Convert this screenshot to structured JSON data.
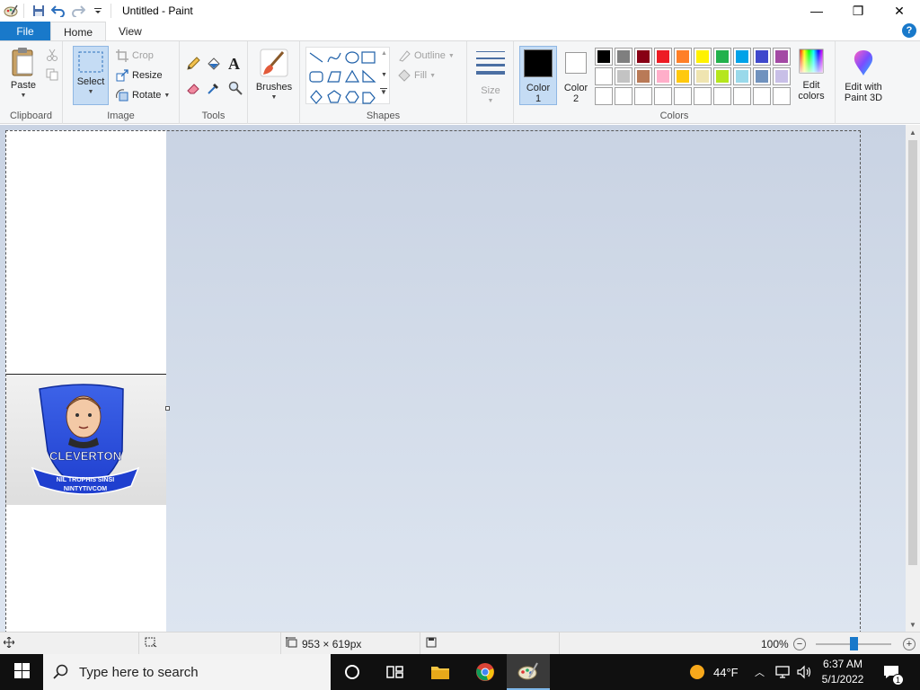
{
  "window": {
    "title": "Untitled - Paint",
    "minimize_glyph": "—",
    "restore_glyph": "❐",
    "close_glyph": "✕"
  },
  "tabs": [
    {
      "label": "File"
    },
    {
      "label": "Home"
    },
    {
      "label": "View"
    }
  ],
  "help_glyph": "?",
  "ribbon": {
    "clipboard": {
      "label": "Clipboard",
      "paste": "Paste"
    },
    "image": {
      "label": "Image",
      "select": "Select",
      "crop": "Crop",
      "resize": "Resize",
      "rotate": "Rotate"
    },
    "tools": {
      "label": "Tools",
      "text_glyph": "A"
    },
    "brushes": {
      "label": "Brushes"
    },
    "shapes": {
      "label": "Shapes",
      "outline": "Outline",
      "fill": "Fill"
    },
    "size": {
      "label": "Size"
    },
    "colors": {
      "label": "Colors",
      "color1_line1": "Color",
      "color1_line2": "1",
      "color2_line1": "Color",
      "color2_line2": "2",
      "edit_colors_line1": "Edit",
      "edit_colors_line2": "colors",
      "color1_value": "#000000",
      "color2_value": "#ffffff",
      "palette": [
        "#000000",
        "#7f7f7f",
        "#880015",
        "#ed1c24",
        "#ff7f27",
        "#fff200",
        "#22b14c",
        "#00a2e8",
        "#3f48cc",
        "#a349a4",
        "#ffffff",
        "#c3c3c3",
        "#b97a57",
        "#ffaec9",
        "#ffc90e",
        "#efe4b0",
        "#b5e61d",
        "#99d9ea",
        "#7092be",
        "#c8bfe7",
        "#ffffff",
        "#ffffff",
        "#ffffff",
        "#ffffff",
        "#ffffff",
        "#ffffff",
        "#ffffff",
        "#ffffff",
        "#ffffff",
        "#ffffff"
      ]
    },
    "paint3d": {
      "line1": "Edit with",
      "line2": "Paint 3D"
    }
  },
  "canvas": {
    "pasted_image": {
      "crest_text": "CLEVERTON",
      "banner_line1": "NIL TROPHIS SINSI",
      "banner_line2": "NINTYTIVCOM"
    }
  },
  "statusbar": {
    "selection_size": "953 × 619px",
    "zoom": "100%",
    "zoom_level_percent": 100
  },
  "taskbar": {
    "search_placeholder": "Type here to search",
    "weather": "44°F",
    "time": "6:37 AM",
    "date": "5/1/2022",
    "notification_count": "1"
  }
}
